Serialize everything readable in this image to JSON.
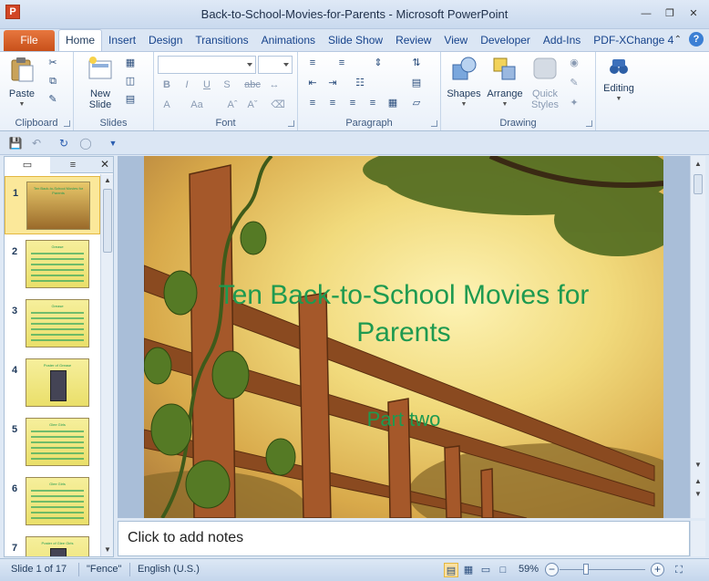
{
  "window": {
    "title": "Back-to-School-Movies-for-Parents  -  Microsoft PowerPoint",
    "app_icon": "P"
  },
  "tabs": {
    "file": "File",
    "items": [
      "Home",
      "Insert",
      "Design",
      "Transitions",
      "Animations",
      "Slide Show",
      "Review",
      "View",
      "Developer",
      "Add-Ins",
      "PDF-XChange 4"
    ],
    "active": "Home"
  },
  "ribbon": {
    "clipboard": {
      "label": "Clipboard",
      "paste": "Paste"
    },
    "slides": {
      "label": "Slides",
      "new_slide": "New\nSlide"
    },
    "font": {
      "label": "Font"
    },
    "paragraph": {
      "label": "Paragraph"
    },
    "drawing": {
      "label": "Drawing",
      "shapes": "Shapes",
      "arrange": "Arrange",
      "quick_styles": "Quick\nStyles"
    },
    "editing": {
      "label": "Editing"
    }
  },
  "left_pane": {
    "slides": [
      {
        "num": "1",
        "title": "Ten Back-to-School Movies for Parents"
      },
      {
        "num": "2",
        "title": "Grease"
      },
      {
        "num": "3",
        "title": "Grease"
      },
      {
        "num": "4",
        "title": "Poster of Grease"
      },
      {
        "num": "5",
        "title": "Glee Girls"
      },
      {
        "num": "6",
        "title": "Glee Girls"
      },
      {
        "num": "7",
        "title": "Poster of Glee Girls"
      }
    ],
    "selected": "1"
  },
  "slide": {
    "title": "Ten Back-to-School Movies for Parents",
    "subtitle": "Part two"
  },
  "notes": {
    "placeholder": "Click to add notes"
  },
  "status": {
    "slide_info": "Slide 1 of 17",
    "theme": "\"Fence\"",
    "language": "English (U.S.)",
    "zoom": "59%"
  },
  "colors": {
    "accent_file_tab": "#d35d22",
    "slide_text": "#1e9a50",
    "selection": "#fbe89a"
  }
}
